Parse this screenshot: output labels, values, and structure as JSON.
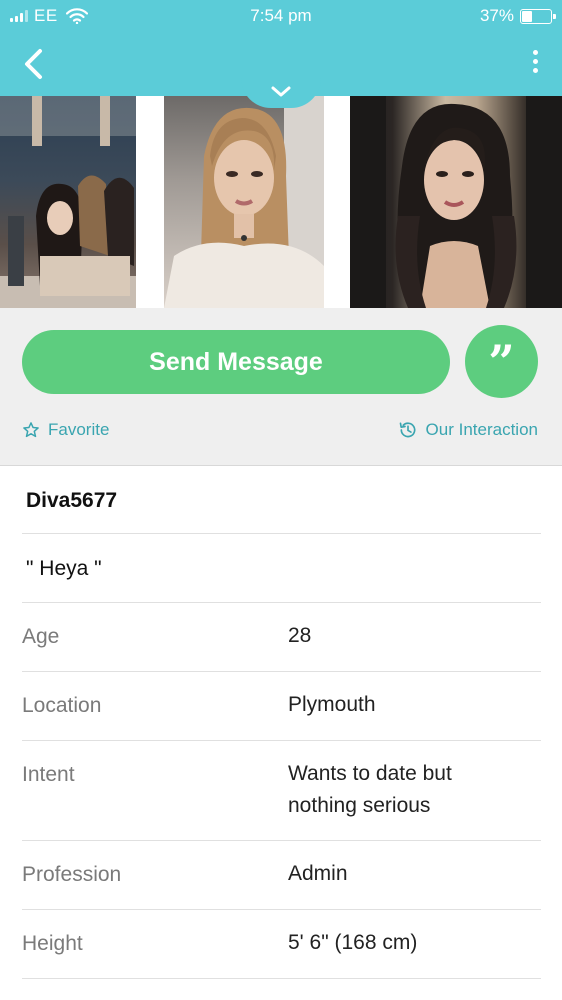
{
  "status_bar": {
    "carrier": "EE",
    "time": "7:54 pm",
    "battery_percent": "37%",
    "battery_level": 0.37
  },
  "nav": {
    "back_icon": "chevron-left-icon",
    "more_icon": "more-vertical-icon",
    "collapse_icon": "chevron-down-icon"
  },
  "photos": [
    {
      "name": "profile-photo-1"
    },
    {
      "name": "profile-photo-2"
    },
    {
      "name": "profile-photo-3"
    }
  ],
  "actions": {
    "send_message_label": "Send Message",
    "quote_label": "99",
    "favorite_label": "Favorite",
    "interaction_label": "Our Interaction"
  },
  "colors": {
    "header": "#5bccd8",
    "primary_green": "#5dcd7f",
    "link_teal": "#3aa5b0"
  },
  "profile": {
    "username": "Diva5677",
    "tagline": "\" Heya \"",
    "fields": [
      {
        "label": "Age",
        "value": "28"
      },
      {
        "label": "Location",
        "value": "Plymouth"
      },
      {
        "label": "Intent",
        "value": "Wants to date but nothing serious"
      },
      {
        "label": "Profession",
        "value": "Admin"
      },
      {
        "label": "Height",
        "value": "5' 6\" (168 cm)"
      }
    ]
  }
}
